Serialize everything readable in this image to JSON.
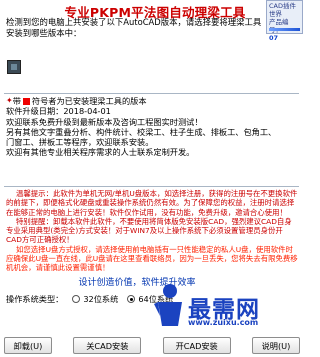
{
  "title": "专业PKPM平法图自动理梁工具",
  "product": {
    "line1": "CAD插件世界",
    "line2": "产品编号：",
    "code": "07"
  },
  "detect_text": "检测到您的电脑上共安装了以下AutoCAD版本，请选择要将理梁工具安装到哪些版本中：",
  "legend": {
    "prefix": "带",
    "suffix": "符号者为已安装理梁工具的版本"
  },
  "info": {
    "version": "软件升级日期：2018-04-01",
    "line2": "欢迎联系免费升级到最新版本及咨询工程图实时测试！",
    "line3": "另有其他文字重叠分析、构件统计、校梁工、柱子生成、排板工、包角工、",
    "line4": "门窗工、拼板工等程序，欢迎联系安装。",
    "line5": "欢迎有其他专业相关程序需求的人士联系定制开发。"
  },
  "notice": {
    "p1": "温馨提示：此软件为单机无网/单机U盘版本，如选择注册，获得的注册号在不更换软件的前提下，即便格式化硬盘或重装操作系统仍然有效。为了保障您的权益，注册时请选择在能够正常的电脑上进行安装！软件仅作试用，没有功能，免费升级，邀请合心使用！",
    "p2": "特别提醒：卸载本软件此软件，不要使用将简体版免安装版CAD，强烈建议CAD自身专业采用典型(类完全)方式安装！对于WIN7及以上操作系统下必须设置管理员身份开CAD方可正确授权！",
    "p3": "如您选择U盘方式授权，请选择使用前电脑插有一只性能稳定的私人U盘，使用软件时应确保此U盘一直在线，此U盘请在这里查看联络员，因为一旦丢失，您将失去有限免费移机机会，请谨慎此设置需谨慎！"
  },
  "slogan": "设计创造价值，软件提升效率",
  "os": {
    "label": "操作系统类型：",
    "opt32": "32位系统",
    "opt64": "64位系统",
    "selected": "64"
  },
  "buttons": {
    "uninstall": "卸载(U)",
    "close_cad": "关CAD安装",
    "open_cad": "开CAD安装",
    "help": "说明(U)"
  },
  "watermark": {
    "brand": "最需网",
    "url": "www.zuixu.com"
  }
}
